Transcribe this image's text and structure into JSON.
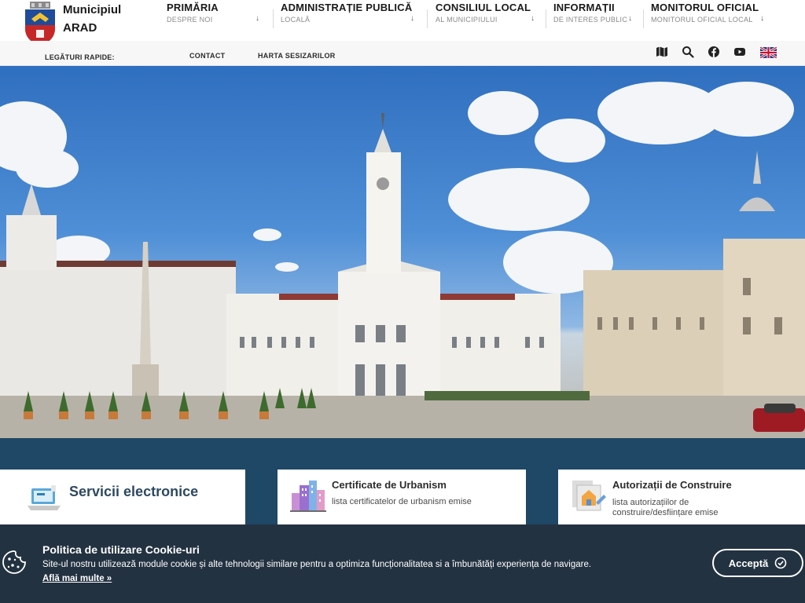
{
  "header": {
    "logo_line1": "Municipiul",
    "logo_line2": "ARAD",
    "nav": [
      {
        "title": "PRIMĂRIA",
        "sub": "DESPRE NOI"
      },
      {
        "title": "ADMINISTRAȚIE PUBLICĂ",
        "sub": "LOCALĂ"
      },
      {
        "title": "CONSILIUL LOCAL",
        "sub": "AL MUNICIPIULUI"
      },
      {
        "title": "INFORMAȚII",
        "sub": "DE INTERES PUBLIC"
      },
      {
        "title": "MONITORUL OFICIAL",
        "sub": "MONITORUL OFICIAL LOCAL"
      }
    ],
    "arrow": "↓"
  },
  "quickbar": {
    "label": "LEGĂTURI RAPIDE:",
    "links": [
      "CONTACT",
      "HARTA SESIZARILOR"
    ],
    "tools": [
      "map-icon",
      "search-icon",
      "facebook-icon",
      "youtube-icon",
      "uk-flag-icon"
    ]
  },
  "cards": [
    {
      "title": "Servicii electronice",
      "desc": ""
    },
    {
      "title": "Certificate de Urbanism",
      "desc": "lista certificatelor de urbanism emise"
    },
    {
      "title": "Autorizații de Construire",
      "desc": "lista autorizațiilor de construire/desființare emise"
    }
  ],
  "cookie": {
    "title": "Politica de utilizare Cookie-uri",
    "text": "Site-ul nostru utilizează module cookie și alte tehnologii similare pentru a optimiza funcționalitatea si a îmbunătăți experiența de navigare.",
    "more": "Află mai multe »",
    "accept": "Acceptă"
  },
  "colors": {
    "background": "#1f4766",
    "cookie_bg": "#233241",
    "card_title": "#2d4960"
  }
}
